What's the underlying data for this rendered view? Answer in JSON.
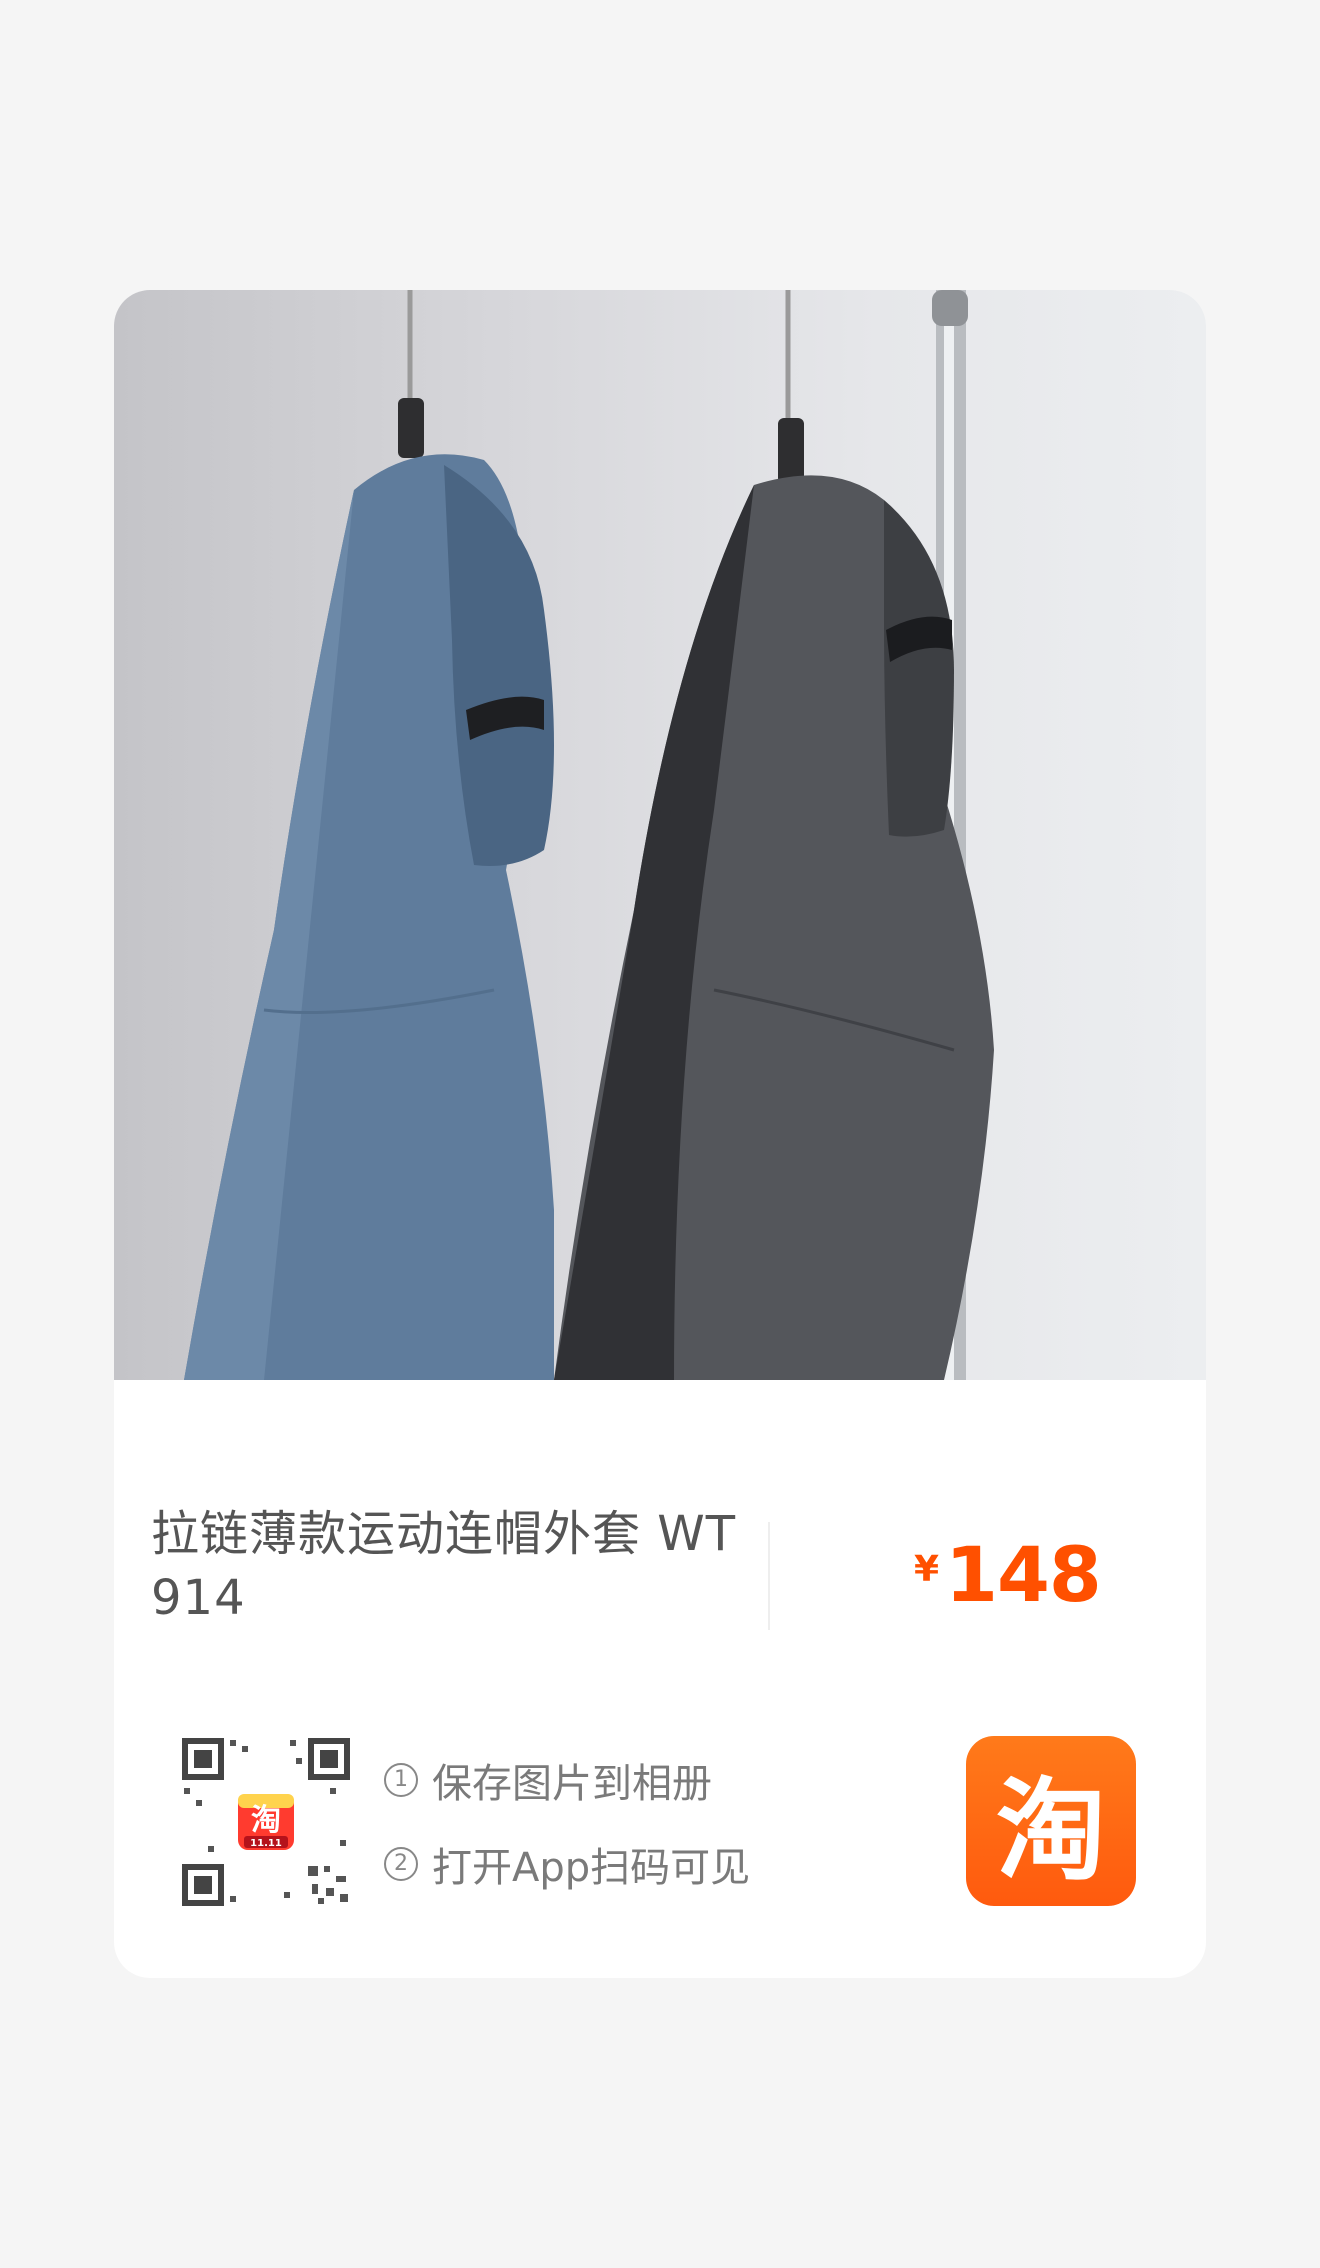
{
  "product": {
    "title": "拉链薄款运动连帽外套 WT 914",
    "price_currency": "¥",
    "price_amount": "148"
  },
  "instructions": {
    "step1_number": "1",
    "step1_text": "保存图片到相册",
    "step2_number": "2",
    "step2_text": "打开App扫码可见"
  },
  "qr_badge": {
    "icon_char": "淘",
    "event_label": "11.11"
  },
  "brand": {
    "logo_char": "淘",
    "color": "#ff5000"
  },
  "photo": {
    "icon": "product-photo",
    "subject": "two hooded jackets on hangers"
  }
}
